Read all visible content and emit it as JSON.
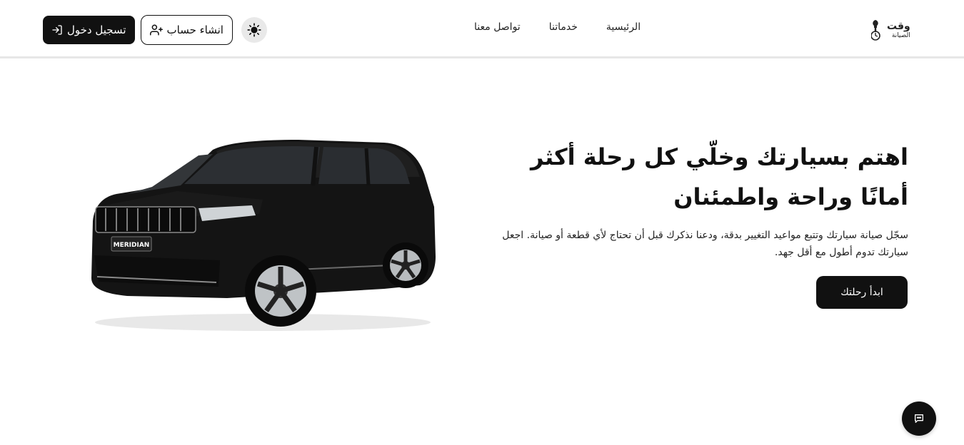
{
  "header": {
    "logo": {
      "main": "وقت",
      "sub": "الصيانة"
    },
    "nav": [
      {
        "label": "الرئيسية"
      },
      {
        "label": "خدماتنا"
      },
      {
        "label": "تواصل معنا"
      }
    ],
    "login_label": "تسجيل دخول",
    "register_label": "انشاء حساب",
    "theme_icon": "sun-icon"
  },
  "hero": {
    "title": "اهتم بسيارتك وخلّي كل رحلة أكثر أمانًا وراحة واطمئنان",
    "description": "سجّل صيانة سيارتك وتتبع مواعيد التغيير بدقة، ودعنا نذكرك قبل أن تحتاج لأي قطعة أو صيانة. اجعل سيارتك تدوم أطول مع أقل جهد.",
    "cta_label": "ابدأ رحلتك",
    "car_badge": "MERIDIAN"
  },
  "chat": {
    "icon": "chat-icon"
  },
  "colors": {
    "primary": "#111111",
    "background": "#ffffff",
    "theme_btn": "#e9e9e9"
  }
}
